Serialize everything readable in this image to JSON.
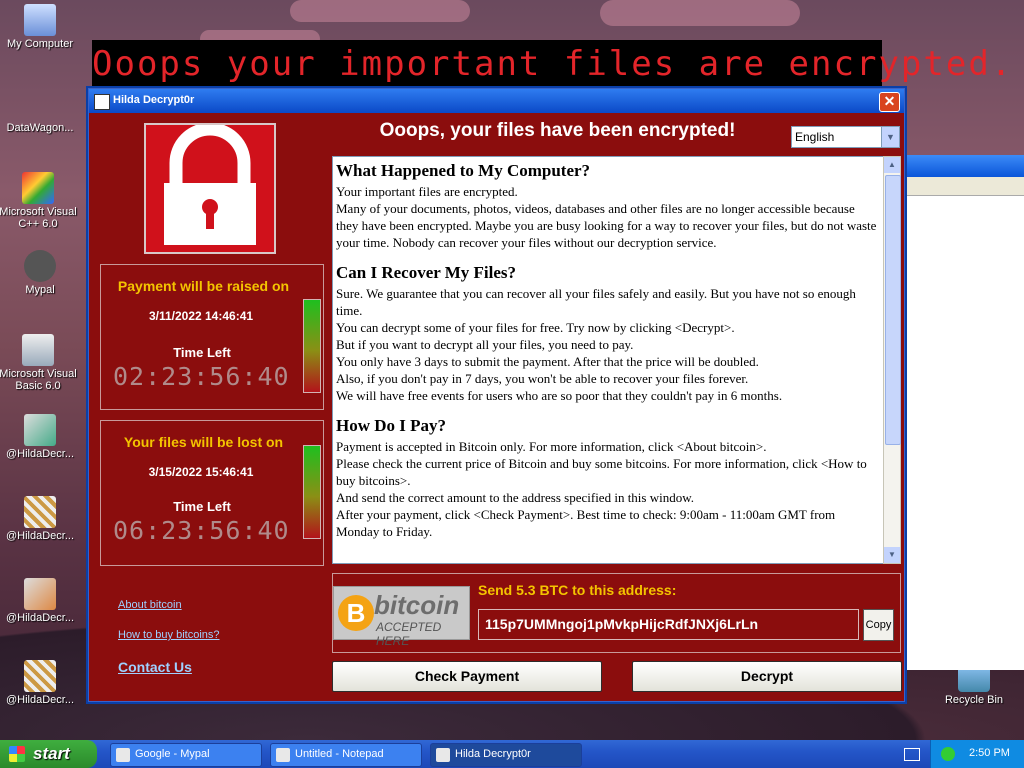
{
  "desktop": {
    "banner": "Ooops your important files are encrypted.",
    "icons": [
      {
        "label": "My Computer"
      },
      {
        "label": "DataWagon..."
      },
      {
        "label": "Microsoft Visual C++ 6.0"
      },
      {
        "label": "Mypal"
      },
      {
        "label": "Microsoft Visual Basic 6.0"
      },
      {
        "label": "@HildaDecr..."
      },
      {
        "label": "@HildaDecr..."
      },
      {
        "label": "@HildaDecr..."
      },
      {
        "label": "@HildaDecr..."
      },
      {
        "label": "Recycle Bin"
      }
    ]
  },
  "window": {
    "title": "Hilda Decrypt0r",
    "headline": "Ooops, your files have been encrypted!",
    "language": "English",
    "panels": [
      {
        "header": "Payment will be raised on",
        "date": "3/11/2022 14:46:41",
        "time_left_label": "Time Left",
        "timer": "02:23:56:40"
      },
      {
        "header": "Your files will be lost on",
        "date": "3/15/2022 15:46:41",
        "time_left_label": "Time Left",
        "timer": "06:23:56:40"
      }
    ],
    "links": {
      "about": "About bitcoin",
      "how_to_buy": "How to buy bitcoins?",
      "contact": "Contact Us"
    },
    "sections": [
      {
        "heading": "What Happened to My Computer?",
        "paragraphs": [
          "Your important files are encrypted.",
          "Many of your documents, photos, videos, databases and other files are no longer accessible because they have been encrypted. Maybe you are busy looking for a way to recover your files, but do not waste your time. Nobody can recover your files without our decryption service."
        ]
      },
      {
        "heading": "Can I Recover My Files?",
        "paragraphs": [
          "Sure. We guarantee that you can recover all your files safely and easily. But you have not so enough time.",
          "You can decrypt some of your files for free. Try now by clicking <Decrypt>.",
          "But if you want to decrypt all your files, you need to pay.",
          "You only have 3 days to submit the payment. After that the price will be doubled.",
          "Also, if you don't pay in 7 days, you won't be able to recover your files forever.",
          "We will have free events for users who are so poor that they couldn't pay in 6 months."
        ]
      },
      {
        "heading": "How Do I Pay?",
        "paragraphs": [
          "Payment is accepted in Bitcoin only. For more information, click <About bitcoin>.",
          "Please check the current price of Bitcoin and buy some bitcoins. For more information, click <How to buy bitcoins>.",
          "And send the correct amount to the address specified in this window.",
          "After your payment, click <Check Payment>. Best time to check: 9:00am - 11:00am GMT from Monday to Friday."
        ]
      }
    ],
    "payment": {
      "bitcoin_word": "bitcoin",
      "accepted": "ACCEPTED HERE",
      "send_label": "Send 5.3 BTC to this address:",
      "address": "115p7UMMngoj1pMvkpHijcRdfJNXj6LrLn",
      "copy": "Copy"
    },
    "buttons": {
      "check_payment": "Check Payment",
      "decrypt": "Decrypt"
    }
  },
  "taskbar": {
    "start": "start",
    "tasks": [
      {
        "label": "Google - Mypal"
      },
      {
        "label": "Untitled - Notepad"
      },
      {
        "label": "Hilda Decrypt0r"
      }
    ],
    "clock": "2:50 PM"
  }
}
